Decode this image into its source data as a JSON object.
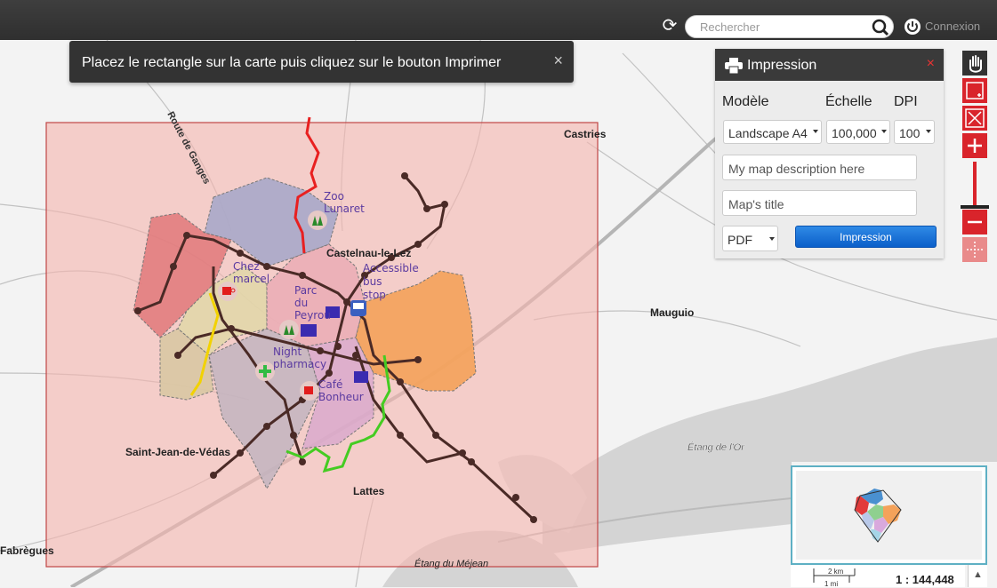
{
  "header": {
    "search_placeholder": "Rechercher",
    "login_label": "Connexion"
  },
  "toast": {
    "message": "Placez le rectangle sur la carte puis cliquez sur le bouton Imprimer",
    "close": "×"
  },
  "print_panel": {
    "title": "Impression",
    "close": "×",
    "labels": {
      "model": "Modèle",
      "scale": "Échelle",
      "dpi": "DPI"
    },
    "model_value": "Landscape A4",
    "scale_value": "100,000",
    "dpi_value": "100",
    "description_placeholder": "My map description here",
    "title_placeholder": "Map's title",
    "format_value": "PDF",
    "print_button": "Impression"
  },
  "map": {
    "places": [
      "Castries",
      "Mauguio",
      "Saint-Jean-de-Védas",
      "Lattes",
      "Fabrègues",
      "Castelnau-le-Lez",
      "Route de Ganges"
    ],
    "water_labels": [
      "Étang de l'Or",
      "Étang du Méjean"
    ],
    "pois": {
      "zoo": "Zoo\nLunaret",
      "chez_marcel": "Chez\nmarcel",
      "parc": "Parc\ndu\nPeyrou",
      "bus": "Accessible\nbus\nstop",
      "pharmacy": "Night\npharmacy",
      "cafe": "Café\nBonheur"
    },
    "colors": {
      "print_area": "#f4b5ae",
      "red_line": "#e82020",
      "green_line": "#44cc22",
      "yellow_line": "#f2d200",
      "orange_zone": "#f4a25a"
    }
  },
  "minimap": {
    "scale_km": "2 km",
    "scale_mi": "1 mi",
    "ratio": "1 : 144,448"
  }
}
